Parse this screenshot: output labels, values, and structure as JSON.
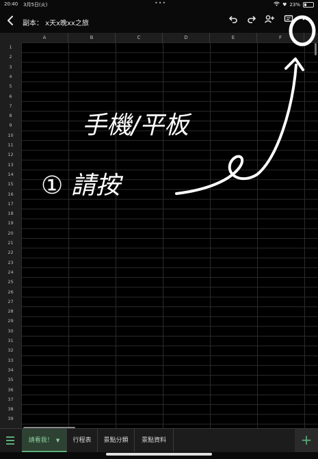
{
  "status": {
    "time": "20:40",
    "date": "3月5日(火)",
    "dots": "•••",
    "battery": "23%"
  },
  "toolbar": {
    "title": "副本： x天x晚xx之旅",
    "back_icon": "chevron-left-icon",
    "undo_icon": "undo-icon",
    "redo_icon": "redo-icon",
    "share_icon": "add-person-icon",
    "comment_icon": "comment-icon",
    "more_icon": "more-horizontal-icon"
  },
  "sheet": {
    "columns": [
      "A",
      "B",
      "C",
      "D",
      "E",
      "F"
    ],
    "rows": [
      "1",
      "2",
      "3",
      "4",
      "5",
      "6",
      "7",
      "8",
      "9",
      "10",
      "11",
      "12",
      "13",
      "14",
      "15",
      "16",
      "17",
      "18",
      "19",
      "20",
      "21",
      "22",
      "23",
      "24",
      "25",
      "26",
      "27",
      "28",
      "29",
      "30",
      "31",
      "32",
      "33",
      "34",
      "35",
      "36",
      "37",
      "38",
      "39"
    ]
  },
  "annotation": {
    "line1": "手機/平板",
    "line2": "① 請按"
  },
  "tabs": {
    "items": [
      {
        "label": "請看我！"
      },
      {
        "label": "行程表"
      },
      {
        "label": "景點分類"
      },
      {
        "label": "景點資料"
      }
    ],
    "accent": "#5cae7a"
  }
}
